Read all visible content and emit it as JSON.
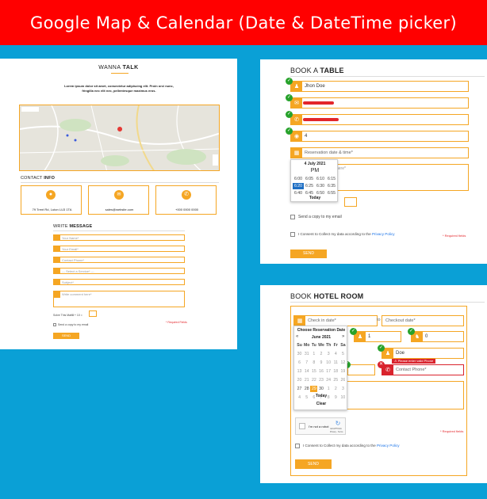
{
  "banner": {
    "title": "Google Map & Calendar (Date & DateTime picker)"
  },
  "colors": {
    "accent": "#f5a623",
    "background": "#0aa0d6",
    "banner": "#ff0000",
    "valid": "#27a22b",
    "error": "#d9232d"
  },
  "contact_page": {
    "brand_first": "WANNA ",
    "brand_second": "TALK",
    "intro": "Lorem ipsum dolor sit amet, consectetur adipiscing elit. Proin orci nunc, fringilla nec elit nec, pellentesque maximus eros.",
    "section_contact_a": "CONTACT ",
    "section_contact_b": "INFO",
    "address": "79 Trent Rd, Luton LU3 1TA",
    "email": "sales@website.com",
    "phone": "+000 0000 0000",
    "section_message_a": "WRITE ",
    "section_message_b": "MESSAGE",
    "fields": [
      "Your Name*",
      "Your Email*",
      "Contact Phone*",
      "--- Select a Service* ---",
      "Subject*",
      "Write comment here*"
    ],
    "captcha_label": "Solve This Math:",
    "captcha_expr": "3  +  10  =",
    "copy_label": "Send a copy to my email",
    "required": "* Required Fields",
    "send": "SEND"
  },
  "table_page": {
    "title_a": "BOOK A ",
    "title_b": "TABLE",
    "name_value": "Jhon Doe",
    "guests_value": "4",
    "reservation_placeholder": "Reservation date & time*",
    "comment_hint": "here*",
    "time_picker": {
      "date": "4 July 2021",
      "period": "PM",
      "times": [
        [
          "6:00",
          "6:05",
          "6:10",
          "6:15"
        ],
        [
          "6:20",
          "6:25",
          "6:30",
          "6:35"
        ],
        [
          "6:40",
          "6:45",
          "6:50",
          "6:55"
        ]
      ],
      "selected": "6:20",
      "today": "Today"
    },
    "copy_label": "Send a copy to my email",
    "consent_a": "I Consent to Collect my data according to the ",
    "consent_link": "Privacy Policy",
    "required": "* Required fields",
    "send": "SEND"
  },
  "hotel_page": {
    "title_a": "BOOK ",
    "title_b": "HOTEL ROOM",
    "checkin": "Check in date*",
    "checkout": "Checkout date*",
    "to": "to",
    "adults": "1",
    "children": "0",
    "name_value": "Doe",
    "error_msg": "Please enter valid Phone",
    "phone_placeholder": "Contact Phone*",
    "date_picker": {
      "heading": "Choose Reservation Date",
      "month": "June 2021",
      "prev": "«",
      "next": "»",
      "days": [
        "Su",
        "Mo",
        "Tu",
        "We",
        "Th",
        "Fr",
        "Sa"
      ],
      "weeks": [
        [
          "30",
          "31",
          "1",
          "2",
          "3",
          "4",
          "5"
        ],
        [
          "6",
          "7",
          "8",
          "9",
          "10",
          "11",
          "12"
        ],
        [
          "13",
          "14",
          "15",
          "16",
          "17",
          "18",
          "19"
        ],
        [
          "20",
          "21",
          "22",
          "23",
          "24",
          "25",
          "26"
        ],
        [
          "27",
          "28",
          "29",
          "30",
          "1",
          "2",
          "3"
        ],
        [
          "4",
          "5",
          "6",
          "7",
          "8",
          "9",
          "10"
        ]
      ],
      "selected": "29",
      "today": "Today",
      "clear": "Clear"
    },
    "recaptcha": "I'm not a robot",
    "recaptcha_brand": "reCAPTCHA",
    "recaptcha_terms": "Privacy - Terms",
    "required": "* Required fields",
    "consent_a": "I Consent to Collect my data according to the ",
    "consent_link": "Privacy Policy",
    "send": "SEND"
  }
}
